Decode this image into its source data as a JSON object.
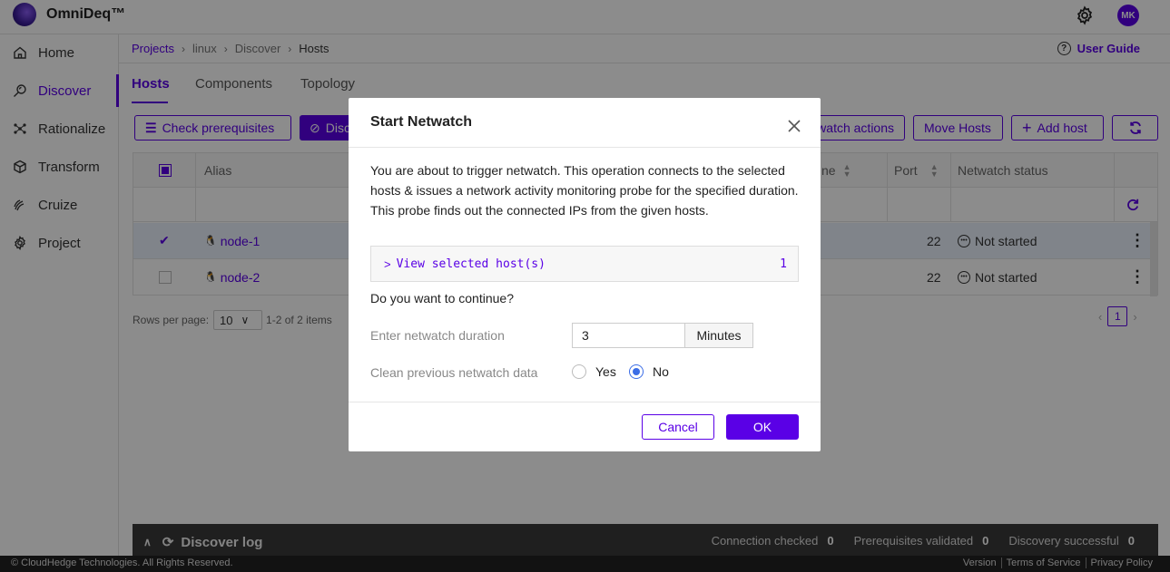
{
  "app": {
    "name": "OmniDeq™",
    "user_initials": "MK"
  },
  "sidebar": {
    "items": [
      {
        "label": "Home",
        "icon": "home-icon"
      },
      {
        "label": "Discover",
        "icon": "discover-icon",
        "active": true
      },
      {
        "label": "Rationalize",
        "icon": "rationalize-icon"
      },
      {
        "label": "Transform",
        "icon": "cube-icon"
      },
      {
        "label": "Cruize",
        "icon": "cruize-icon"
      },
      {
        "label": "Project",
        "icon": "gear-icon"
      }
    ]
  },
  "breadcrumb": {
    "items": [
      "Projects",
      "linux",
      "Discover",
      "Hosts"
    ]
  },
  "user_guide": "User Guide",
  "tabs": [
    "Hosts",
    "Components",
    "Topology"
  ],
  "toolbar": {
    "check_prereq": "Check prerequisites",
    "discover": "Discover",
    "netwatch_actions": "Netwatch actions",
    "move_hosts": "Move Hosts",
    "add_host": "Add host"
  },
  "table": {
    "headers": {
      "alias": "Alias",
      "name_partial": "ne",
      "port": "Port",
      "netwatch": "Netwatch status"
    },
    "rows": [
      {
        "alias": "node-1",
        "port": "22",
        "status": "Not started",
        "selected": true
      },
      {
        "alias": "node-2",
        "port": "22",
        "status": "Not started",
        "selected": false
      }
    ]
  },
  "pagination": {
    "rows_per_page_label": "Rows per page:",
    "rows_per_page": "10",
    "range": "1-2 of 2 items",
    "current_page": "1"
  },
  "discover_log": {
    "title": "Discover log",
    "stats": [
      {
        "label": "Connection checked",
        "value": "0"
      },
      {
        "label": "Prerequisites validated",
        "value": "0"
      },
      {
        "label": "Discovery successful",
        "value": "0"
      }
    ]
  },
  "footer": {
    "copyright": "© CloudHedge Technologies. All Rights Reserved.",
    "links": [
      "Version",
      "Terms of Service",
      "Privacy Policy"
    ]
  },
  "modal": {
    "title": "Start Netwatch",
    "description": "You are about to trigger netwatch. This operation connects to the selected hosts & issues a network activity monitoring probe for the specified duration. This probe finds out the connected IPs from the given hosts.",
    "view_selected": "View selected host(s)",
    "selected_count": "1",
    "question": "Do you want to continue?",
    "duration_label": "Enter netwatch duration",
    "duration_value": "3",
    "duration_unit": "Minutes",
    "clean_label": "Clean previous netwatch data",
    "clean_options": [
      "Yes",
      "No"
    ],
    "clean_selected": "No",
    "cancel": "Cancel",
    "ok": "OK"
  },
  "colors": {
    "accent": "#5a00e6",
    "radio": "#3b6de6"
  }
}
